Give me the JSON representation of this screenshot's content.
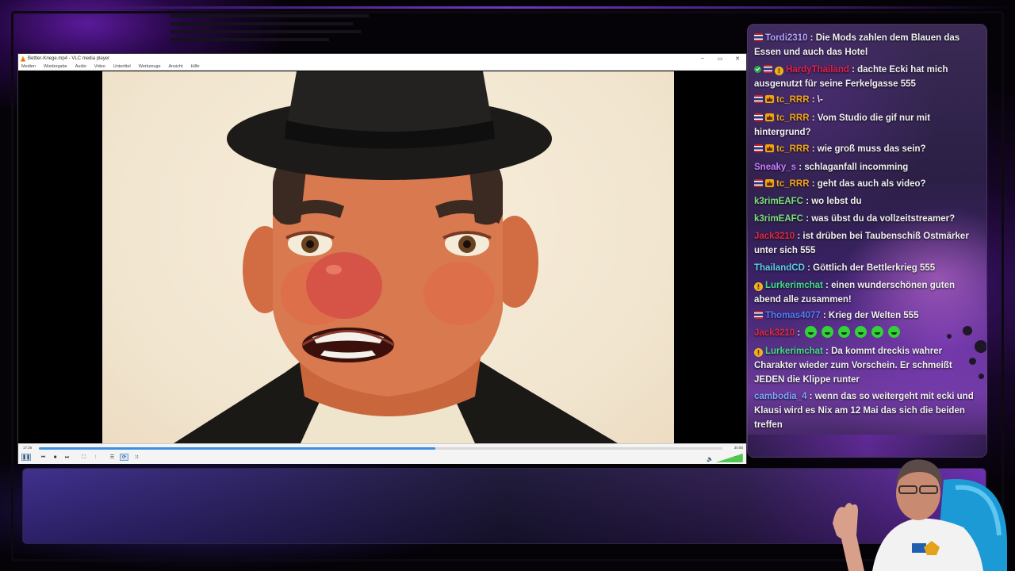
{
  "window": {
    "title": "Bettler-Kriege.mp4 - VLC media player",
    "controls": [
      "–",
      "▭",
      "✕"
    ]
  },
  "menubar": [
    "Medien",
    "Wiedergabe",
    "Audio",
    "Video",
    "Untertitel",
    "Werkzeuge",
    "Ansicht",
    "Hilfe"
  ],
  "playback": {
    "time_elapsed": "17:36",
    "time_total": "30:56",
    "progress": 0.58,
    "volume_label": "100%",
    "volume": 1.0
  },
  "chat": [
    {
      "badges": [
        "flag"
      ],
      "user": "Tordi2310",
      "color": "#b3a2ff",
      "text": "Die Mods zahlen dem Blauen das Essen und auch das Hotel"
    },
    {
      "badges": [
        "check",
        "flag",
        "bits"
      ],
      "user": "HardyThailand",
      "color": "#e0204a",
      "text": "dachte Ecki hat mich ausgenutzt für seine Ferkelgasse 555"
    },
    {
      "badges": [
        "flag",
        "crown"
      ],
      "user": "tc_RRR",
      "color": "#f0a418",
      "text": "\\-"
    },
    {
      "badges": [
        "flag",
        "crown"
      ],
      "user": "tc_RRR",
      "color": "#f0a418",
      "text": "Vom Studio die gif nur mit hintergrund?"
    },
    {
      "badges": [
        "flag",
        "crown"
      ],
      "user": "tc_RRR",
      "color": "#f0a418",
      "text": "wie groß muss das sein?"
    },
    {
      "badges": [],
      "user": "Sneaky_s",
      "color": "#c77dff",
      "text": "schlaganfall incomming"
    },
    {
      "badges": [
        "flag",
        "crown"
      ],
      "user": "tc_RRR",
      "color": "#f0a418",
      "text": "geht das auch als video?"
    },
    {
      "badges": [],
      "user": "k3rimEAFC",
      "color": "#7ee07e",
      "text": "wo lebst du"
    },
    {
      "badges": [],
      "user": "k3rimEAFC",
      "color": "#7ee07e",
      "text": "was übst du da vollzeitstreamer?"
    },
    {
      "badges": [],
      "user": "Jack3210",
      "color": "#e02a40",
      "text": "ist drüben bei Taubenschiß Ostmärker unter sich 555"
    },
    {
      "badges": [],
      "user": "ThailandCD",
      "color": "#5fd0e8",
      "text": "Göttlich der Bettlerkrieg 555"
    },
    {
      "badges": [
        "bits"
      ],
      "user": "Lurkerimchat",
      "color": "#44dd88",
      "text": "einen wunderschönen guten abend alle zusammen!"
    },
    {
      "badges": [
        "flag"
      ],
      "user": "Thomas4077",
      "color": "#4f7fff",
      "text": "Krieg der Welten 555"
    },
    {
      "badges": [],
      "user": "Jack3210",
      "color": "#e02a40",
      "text": "",
      "emotes": 6
    },
    {
      "badges": [
        "bits"
      ],
      "user": "Lurkerimchat",
      "color": "#44dd88",
      "text": "Da kommt dreckis wahrer Charakter wieder zum Vorschein. Er schmeißt JEDEN die Klippe runter"
    },
    {
      "badges": [],
      "user": "cambodia_4",
      "color": "#7fa8ff",
      "text": "wenn das so weitergeht mit ecki und Klausi wird es Nix am 12 Mai das sich die beiden treffen"
    }
  ]
}
